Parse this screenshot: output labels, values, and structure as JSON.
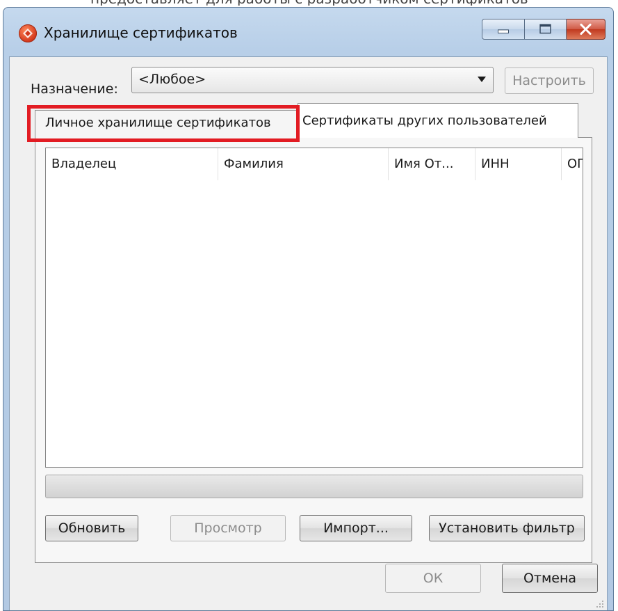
{
  "top_strip_text": "предоставляет для работы с разработчиком сертификатов",
  "window": {
    "title": "Хранилище сертификатов",
    "icon": "certificate-store-icon"
  },
  "purpose": {
    "label": "Назначение:",
    "selected": "<Любое>",
    "configure_label": "Настроить"
  },
  "tabs": [
    {
      "label": "Личное хранилище сертификатов",
      "active": true
    },
    {
      "label": "Сертификаты других пользователей",
      "active": false
    }
  ],
  "highlight_color": "#e21c23",
  "list": {
    "columns": [
      "Владелец",
      "Фамилия",
      "Имя От...",
      "ИНН",
      "ОГ"
    ],
    "rows": []
  },
  "actions": {
    "refresh_label": "Обновить",
    "view_label": "Просмотр",
    "import_label": "Импорт...",
    "filter_label": "Установить фильтр"
  },
  "dialog": {
    "ok_label": "ОК",
    "cancel_label": "Отмена"
  }
}
